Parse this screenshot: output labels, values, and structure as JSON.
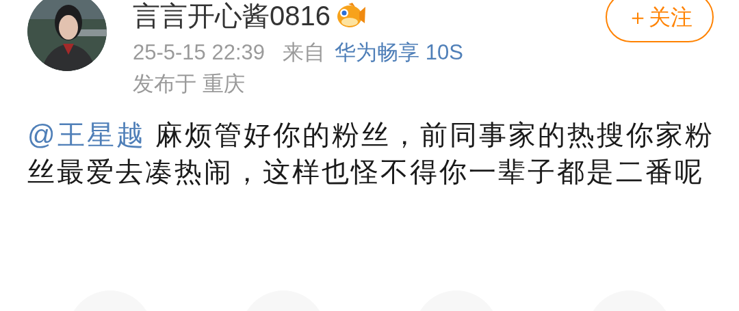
{
  "header": {
    "username": "言言开心酱0816",
    "timestamp": "25-5-15 22:39",
    "source_label": "来自",
    "source": "华为畅享 10S",
    "location": "发布于 重庆",
    "follow_button": "＋关注"
  },
  "post": {
    "mention": "@王星越",
    "text": " 麻烦管好你的粉丝，前同事家的热搜你家粉丝最爱去凑热闹，这样也怪不得你一辈子都是二番呢"
  },
  "actions": [
    {
      "kind": "round"
    },
    {
      "kind": "round"
    },
    {
      "kind": "round"
    },
    {
      "kind": "round"
    }
  ]
}
